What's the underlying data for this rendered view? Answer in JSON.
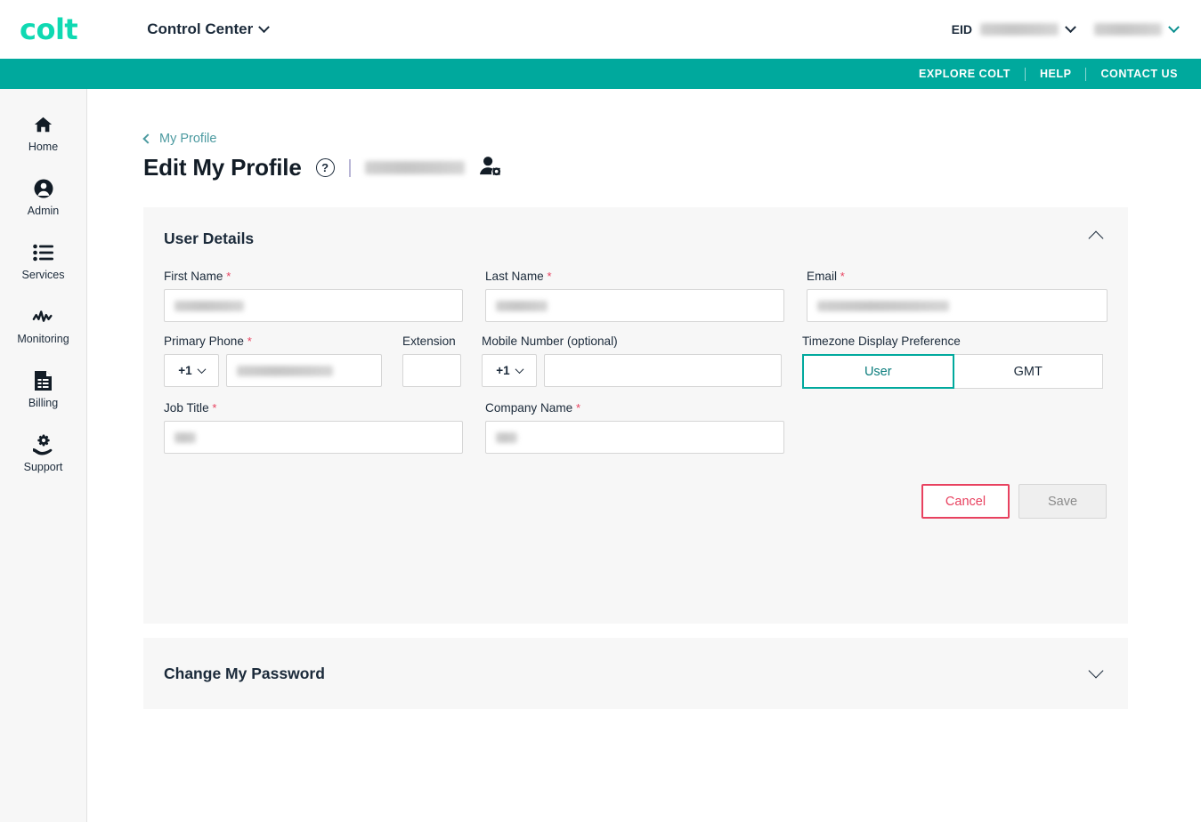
{
  "brand": {
    "logo_text": "colt",
    "logo_color": "#0fd9b2",
    "nav_teal": "#00a99d",
    "accent_pink": "#e8415f"
  },
  "topbar": {
    "app_switcher_label": "Control Center",
    "eid_label": "EID",
    "eid_value": "",
    "account_value": ""
  },
  "tealnav": {
    "items": [
      {
        "label": "EXPLORE COLT"
      },
      {
        "label": "HELP"
      },
      {
        "label": "CONTACT US"
      }
    ]
  },
  "sidebar": {
    "items": [
      {
        "label": "Home",
        "icon": "home-icon"
      },
      {
        "label": "Admin",
        "icon": "user-circle-icon"
      },
      {
        "label": "Services",
        "icon": "list-icon"
      },
      {
        "label": "Monitoring",
        "icon": "activity-icon"
      },
      {
        "label": "Billing",
        "icon": "invoice-icon"
      },
      {
        "label": "Support",
        "icon": "support-hand-icon"
      }
    ]
  },
  "breadcrumb": {
    "label": "My Profile"
  },
  "header": {
    "title": "Edit My Profile",
    "help_glyph": "?",
    "user_name": ""
  },
  "user_details": {
    "section_title": "User Details",
    "expanded": true,
    "fields": {
      "first_name": {
        "label": "First Name",
        "required": true,
        "value": ""
      },
      "last_name": {
        "label": "Last Name",
        "required": true,
        "value": ""
      },
      "email": {
        "label": "Email",
        "required": true,
        "value": ""
      },
      "primary_phone": {
        "label": "Primary Phone",
        "required": true,
        "country_code": "+1",
        "value": ""
      },
      "extension": {
        "label": "Extension",
        "required": false,
        "value": ""
      },
      "mobile_number": {
        "label": "Mobile Number (optional)",
        "required": false,
        "country_code": "+1",
        "value": ""
      },
      "job_title": {
        "label": "Job Title",
        "required": true,
        "value": ""
      },
      "company_name": {
        "label": "Company Name",
        "required": true,
        "value": ""
      }
    },
    "timezone": {
      "label": "Timezone Display Preference",
      "options": [
        "User",
        "GMT"
      ],
      "selected": "User"
    },
    "buttons": {
      "cancel": "Cancel",
      "save": "Save"
    }
  },
  "change_password": {
    "section_title": "Change My Password",
    "expanded": false
  }
}
